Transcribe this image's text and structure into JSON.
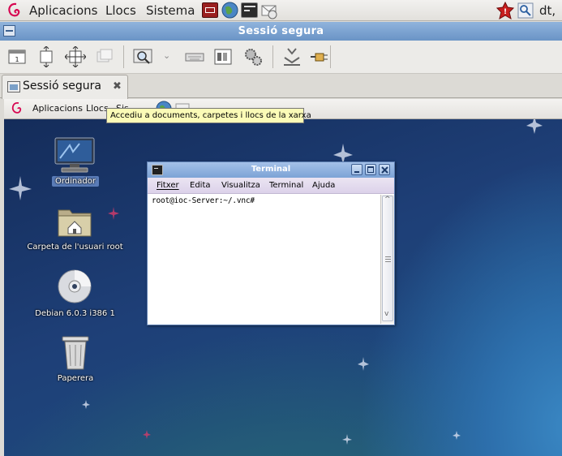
{
  "top_panel": {
    "menus": [
      "Aplicacions",
      "Llocs",
      "Sistema"
    ],
    "clock_partial": "dt,"
  },
  "window": {
    "title": "Sessió segura"
  },
  "tab": {
    "label": "Sessió segura",
    "close_glyph": "✖"
  },
  "remote_panel": {
    "menus": [
      "Aplicacions",
      "Llocs",
      "Sis"
    ]
  },
  "tooltip": "Accediu a documents, carpetes i llocs de la xarxa",
  "desktop_icons": [
    {
      "label": "Ordinador",
      "icon": "computer-icon"
    },
    {
      "label": "Carpeta de l'usuari root",
      "icon": "home-folder-icon"
    },
    {
      "label": "Debian 6.0.3 i386 1",
      "icon": "cd-disc-icon"
    },
    {
      "label": "Paperera",
      "icon": "trash-icon"
    }
  ],
  "terminal": {
    "title": "Terminal",
    "menu": [
      "Fitxer",
      "Edita",
      "Visualitza",
      "Terminal",
      "Ajuda"
    ],
    "prompt": "root@ioc-Server:~/.vnc#"
  },
  "colors": {
    "titlebar": "#7ca3d6",
    "desktop": "#1e3f77",
    "tooltip": "#fbfbb7"
  }
}
